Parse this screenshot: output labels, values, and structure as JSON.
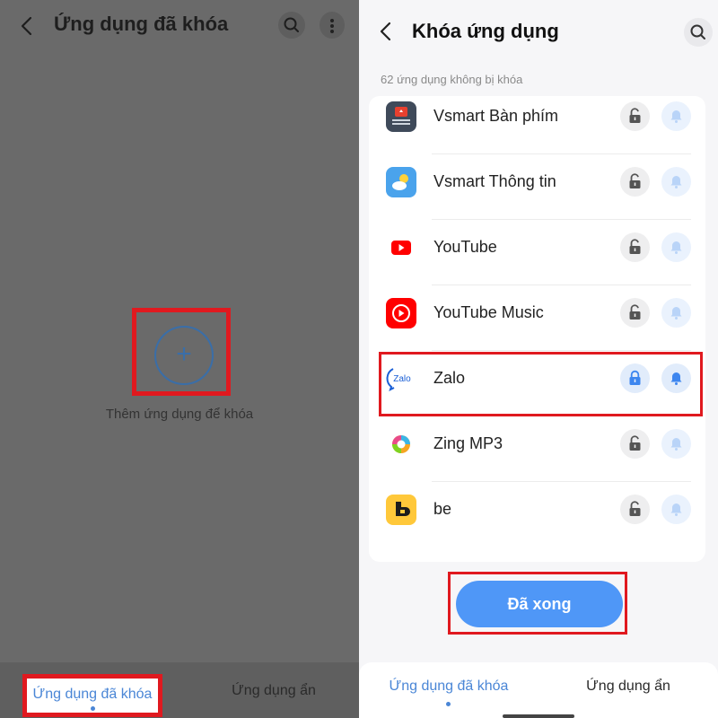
{
  "left": {
    "title": "Ứng dụng đã khóa",
    "add_icon": "plus-icon",
    "add_label": "Thêm ứng dụng để khóa",
    "tabs": [
      {
        "label": "Ứng dụng đã khóa",
        "active": true
      },
      {
        "label": "Ứng dụng ẩn",
        "active": false
      }
    ]
  },
  "right": {
    "title": "Khóa ứng dụng",
    "subtitle": "62 ứng dụng không bị khóa",
    "apps": [
      {
        "name": "Vsmart Bàn phím",
        "icon": "keyboard-app-icon",
        "locked": false
      },
      {
        "name": "Vsmart Thông tin",
        "icon": "weather-app-icon",
        "locked": false
      },
      {
        "name": "YouTube",
        "icon": "youtube-icon",
        "locked": false
      },
      {
        "name": "YouTube Music",
        "icon": "youtube-music-icon",
        "locked": false
      },
      {
        "name": "Zalo",
        "icon": "zalo-icon",
        "icon_text": "Zalo",
        "locked": true
      },
      {
        "name": "Zing MP3",
        "icon": "zing-mp3-icon",
        "locked": false
      },
      {
        "name": "be",
        "icon": "be-app-icon",
        "locked": false
      }
    ],
    "done_label": "Đã xong",
    "tabs": [
      {
        "label": "Ứng dụng đã khóa",
        "active": true
      },
      {
        "label": "Ứng dụng ẩn",
        "active": false
      }
    ]
  },
  "colors": {
    "accent": "#4f97f7",
    "highlight": "#e0191f",
    "dim_overlay": "#6a6a6a"
  }
}
